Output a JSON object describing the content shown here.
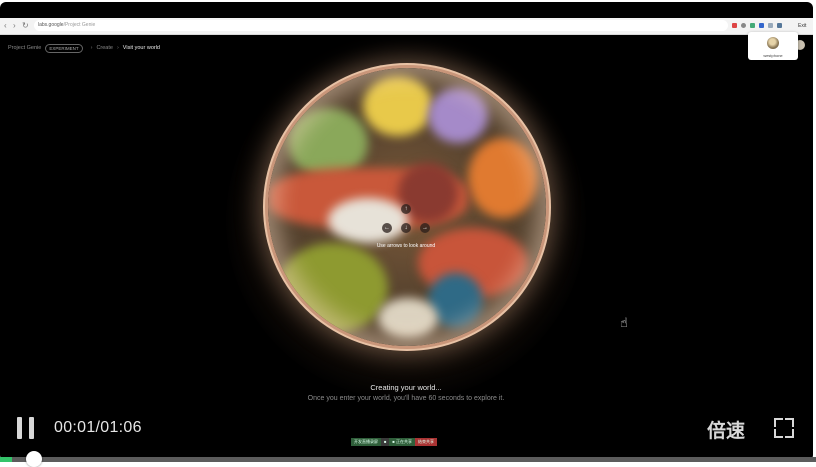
{
  "browser": {
    "url_host": "labs.google",
    "url_path": "/Project Genie",
    "exit_label": "Exit"
  },
  "breadcrumb": {
    "app": "Project Genie",
    "badge": "EXPERIMENT",
    "step": "Create",
    "current": "Visit your world"
  },
  "profile": {
    "name": "westphone"
  },
  "viewer": {
    "hint": "Use arrows to look around"
  },
  "status": {
    "title": "Creating your world...",
    "subtitle": "Once you enter your world, you'll have 60 seconds to explore it."
  },
  "player": {
    "time": "00:01/01:06",
    "speed_label": "倍速",
    "progress_fraction": 0.015
  },
  "taskbar": {
    "items": [
      "开发直播录屏",
      "■",
      "■ 正在共享",
      "结束共享"
    ]
  },
  "colors": {
    "progress": "#34c46a",
    "background": "#000000",
    "rim": "#c9967a"
  }
}
